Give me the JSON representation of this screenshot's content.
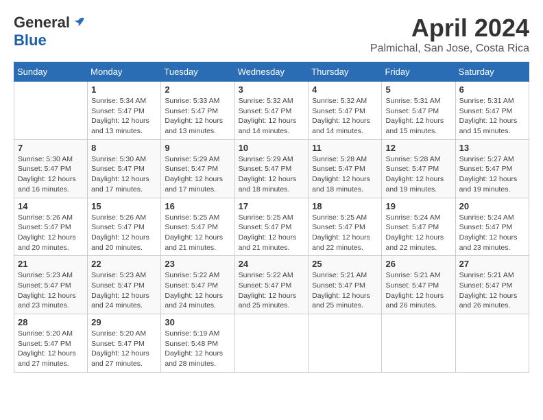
{
  "header": {
    "logo_general": "General",
    "logo_blue": "Blue",
    "title": "April 2024",
    "subtitle": "Palmichal, San Jose, Costa Rica"
  },
  "calendar": {
    "days_of_week": [
      "Sunday",
      "Monday",
      "Tuesday",
      "Wednesday",
      "Thursday",
      "Friday",
      "Saturday"
    ],
    "weeks": [
      [
        {
          "day": "",
          "info": ""
        },
        {
          "day": "1",
          "info": "Sunrise: 5:34 AM\nSunset: 5:47 PM\nDaylight: 12 hours\nand 13 minutes."
        },
        {
          "day": "2",
          "info": "Sunrise: 5:33 AM\nSunset: 5:47 PM\nDaylight: 12 hours\nand 13 minutes."
        },
        {
          "day": "3",
          "info": "Sunrise: 5:32 AM\nSunset: 5:47 PM\nDaylight: 12 hours\nand 14 minutes."
        },
        {
          "day": "4",
          "info": "Sunrise: 5:32 AM\nSunset: 5:47 PM\nDaylight: 12 hours\nand 14 minutes."
        },
        {
          "day": "5",
          "info": "Sunrise: 5:31 AM\nSunset: 5:47 PM\nDaylight: 12 hours\nand 15 minutes."
        },
        {
          "day": "6",
          "info": "Sunrise: 5:31 AM\nSunset: 5:47 PM\nDaylight: 12 hours\nand 15 minutes."
        }
      ],
      [
        {
          "day": "7",
          "info": "Sunrise: 5:30 AM\nSunset: 5:47 PM\nDaylight: 12 hours\nand 16 minutes."
        },
        {
          "day": "8",
          "info": "Sunrise: 5:30 AM\nSunset: 5:47 PM\nDaylight: 12 hours\nand 17 minutes."
        },
        {
          "day": "9",
          "info": "Sunrise: 5:29 AM\nSunset: 5:47 PM\nDaylight: 12 hours\nand 17 minutes."
        },
        {
          "day": "10",
          "info": "Sunrise: 5:29 AM\nSunset: 5:47 PM\nDaylight: 12 hours\nand 18 minutes."
        },
        {
          "day": "11",
          "info": "Sunrise: 5:28 AM\nSunset: 5:47 PM\nDaylight: 12 hours\nand 18 minutes."
        },
        {
          "day": "12",
          "info": "Sunrise: 5:28 AM\nSunset: 5:47 PM\nDaylight: 12 hours\nand 19 minutes."
        },
        {
          "day": "13",
          "info": "Sunrise: 5:27 AM\nSunset: 5:47 PM\nDaylight: 12 hours\nand 19 minutes."
        }
      ],
      [
        {
          "day": "14",
          "info": "Sunrise: 5:26 AM\nSunset: 5:47 PM\nDaylight: 12 hours\nand 20 minutes."
        },
        {
          "day": "15",
          "info": "Sunrise: 5:26 AM\nSunset: 5:47 PM\nDaylight: 12 hours\nand 20 minutes."
        },
        {
          "day": "16",
          "info": "Sunrise: 5:25 AM\nSunset: 5:47 PM\nDaylight: 12 hours\nand 21 minutes."
        },
        {
          "day": "17",
          "info": "Sunrise: 5:25 AM\nSunset: 5:47 PM\nDaylight: 12 hours\nand 21 minutes."
        },
        {
          "day": "18",
          "info": "Sunrise: 5:25 AM\nSunset: 5:47 PM\nDaylight: 12 hours\nand 22 minutes."
        },
        {
          "day": "19",
          "info": "Sunrise: 5:24 AM\nSunset: 5:47 PM\nDaylight: 12 hours\nand 22 minutes."
        },
        {
          "day": "20",
          "info": "Sunrise: 5:24 AM\nSunset: 5:47 PM\nDaylight: 12 hours\nand 23 minutes."
        }
      ],
      [
        {
          "day": "21",
          "info": "Sunrise: 5:23 AM\nSunset: 5:47 PM\nDaylight: 12 hours\nand 23 minutes."
        },
        {
          "day": "22",
          "info": "Sunrise: 5:23 AM\nSunset: 5:47 PM\nDaylight: 12 hours\nand 24 minutes."
        },
        {
          "day": "23",
          "info": "Sunrise: 5:22 AM\nSunset: 5:47 PM\nDaylight: 12 hours\nand 24 minutes."
        },
        {
          "day": "24",
          "info": "Sunrise: 5:22 AM\nSunset: 5:47 PM\nDaylight: 12 hours\nand 25 minutes."
        },
        {
          "day": "25",
          "info": "Sunrise: 5:21 AM\nSunset: 5:47 PM\nDaylight: 12 hours\nand 25 minutes."
        },
        {
          "day": "26",
          "info": "Sunrise: 5:21 AM\nSunset: 5:47 PM\nDaylight: 12 hours\nand 26 minutes."
        },
        {
          "day": "27",
          "info": "Sunrise: 5:21 AM\nSunset: 5:47 PM\nDaylight: 12 hours\nand 26 minutes."
        }
      ],
      [
        {
          "day": "28",
          "info": "Sunrise: 5:20 AM\nSunset: 5:47 PM\nDaylight: 12 hours\nand 27 minutes."
        },
        {
          "day": "29",
          "info": "Sunrise: 5:20 AM\nSunset: 5:47 PM\nDaylight: 12 hours\nand 27 minutes."
        },
        {
          "day": "30",
          "info": "Sunrise: 5:19 AM\nSunset: 5:48 PM\nDaylight: 12 hours\nand 28 minutes."
        },
        {
          "day": "",
          "info": ""
        },
        {
          "day": "",
          "info": ""
        },
        {
          "day": "",
          "info": ""
        },
        {
          "day": "",
          "info": ""
        }
      ]
    ]
  }
}
